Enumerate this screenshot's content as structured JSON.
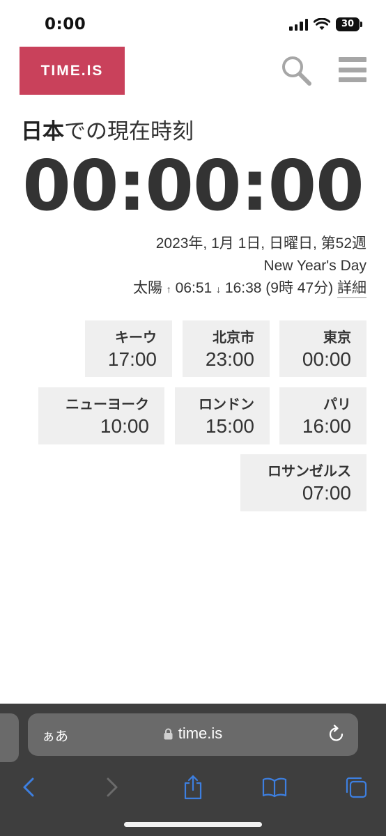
{
  "status_bar": {
    "time": "0:00",
    "battery": "30"
  },
  "header": {
    "logo": "TIME.IS"
  },
  "title": {
    "bold": "日本",
    "rest": "での現在時刻"
  },
  "clock": "00:00:00",
  "date_line": "2023年, 1月 1日, 日曜日, 第52週",
  "holiday": "New Year's Day",
  "sun": {
    "label": "太陽",
    "sunrise_arrow": "↑",
    "sunrise": "06:51",
    "sunset_arrow": "↓",
    "sunset": "16:38",
    "duration": "(9時 47分)",
    "detail_link": "詳細"
  },
  "cities": [
    {
      "name": "キーウ",
      "time": "17:00"
    },
    {
      "name": "北京市",
      "time": "23:00"
    },
    {
      "name": "東京",
      "time": "00:00"
    },
    {
      "name": "ニューヨーク",
      "time": "10:00"
    },
    {
      "name": "ロンドン",
      "time": "15:00"
    },
    {
      "name": "パリ",
      "time": "16:00"
    },
    {
      "name": "ロサンゼルス",
      "time": "07:00"
    }
  ],
  "browser": {
    "aa": "ぁあ",
    "url": "time.is"
  },
  "colors": {
    "brand": "#c9415b",
    "toolbar_blue": "#3d7fe0"
  }
}
